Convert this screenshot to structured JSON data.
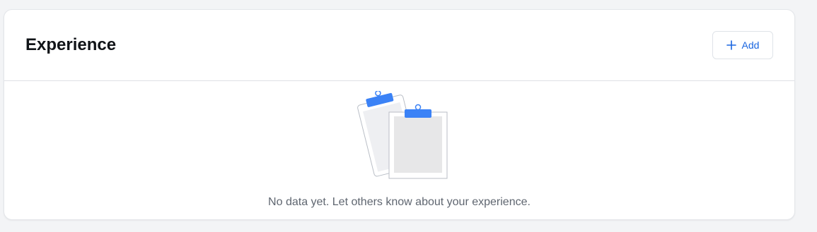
{
  "experience": {
    "title": "Experience",
    "add_button": {
      "label": "Add",
      "icon": "plus-icon"
    },
    "empty_state": {
      "icon": "clipboards-illustration",
      "message": "No data yet. Let others know about your experience."
    }
  },
  "colors": {
    "accent": "#1a66e0",
    "clip": "#3b82f6",
    "page_background": "#f3f4f6",
    "card_background": "#ffffff",
    "muted_text": "#5f6670"
  }
}
